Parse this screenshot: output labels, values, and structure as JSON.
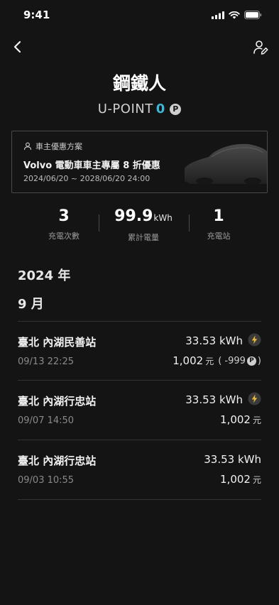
{
  "status": {
    "time": "9:41"
  },
  "profile": {
    "name": "鋼鐵人",
    "points_label": "U-POINT",
    "points_value": "0",
    "points_badge": "P"
  },
  "promo": {
    "header": "車主優惠方案",
    "title": "Volvo 電動車車主專屬 8 折優惠",
    "dates": "2024/06/20 ~ 2028/06/20 24:00"
  },
  "stats": [
    {
      "value": "3",
      "unit": "",
      "label": "充電次數"
    },
    {
      "value": "99.9",
      "unit": "kWh",
      "label": "累計電量"
    },
    {
      "value": "1",
      "unit": "",
      "label": "充電站"
    }
  ],
  "history": {
    "year": "2024 年",
    "month": "9 月",
    "records": [
      {
        "station": "臺北 內湖民善站",
        "time": "09/13 22:25",
        "energy": "33.53 kWh",
        "price": "1,002",
        "price_unit": "元",
        "discount": "( -999",
        "discount_badge": "P",
        "discount_close": ")",
        "bolt": true
      },
      {
        "station": "臺北 內湖行忠站",
        "time": "09/07 14:50",
        "energy": "33.53 kWh",
        "price": "1,002",
        "price_unit": "元",
        "bolt": true
      },
      {
        "station": "臺北 內湖行忠站",
        "time": "09/03 10:55",
        "energy": "33.53 kWh",
        "price": "1,002",
        "price_unit": "元",
        "bolt": false
      }
    ]
  },
  "colors": {
    "accent": "#3fb8d8",
    "background": "#141414",
    "bolt": "#e8b83a"
  }
}
